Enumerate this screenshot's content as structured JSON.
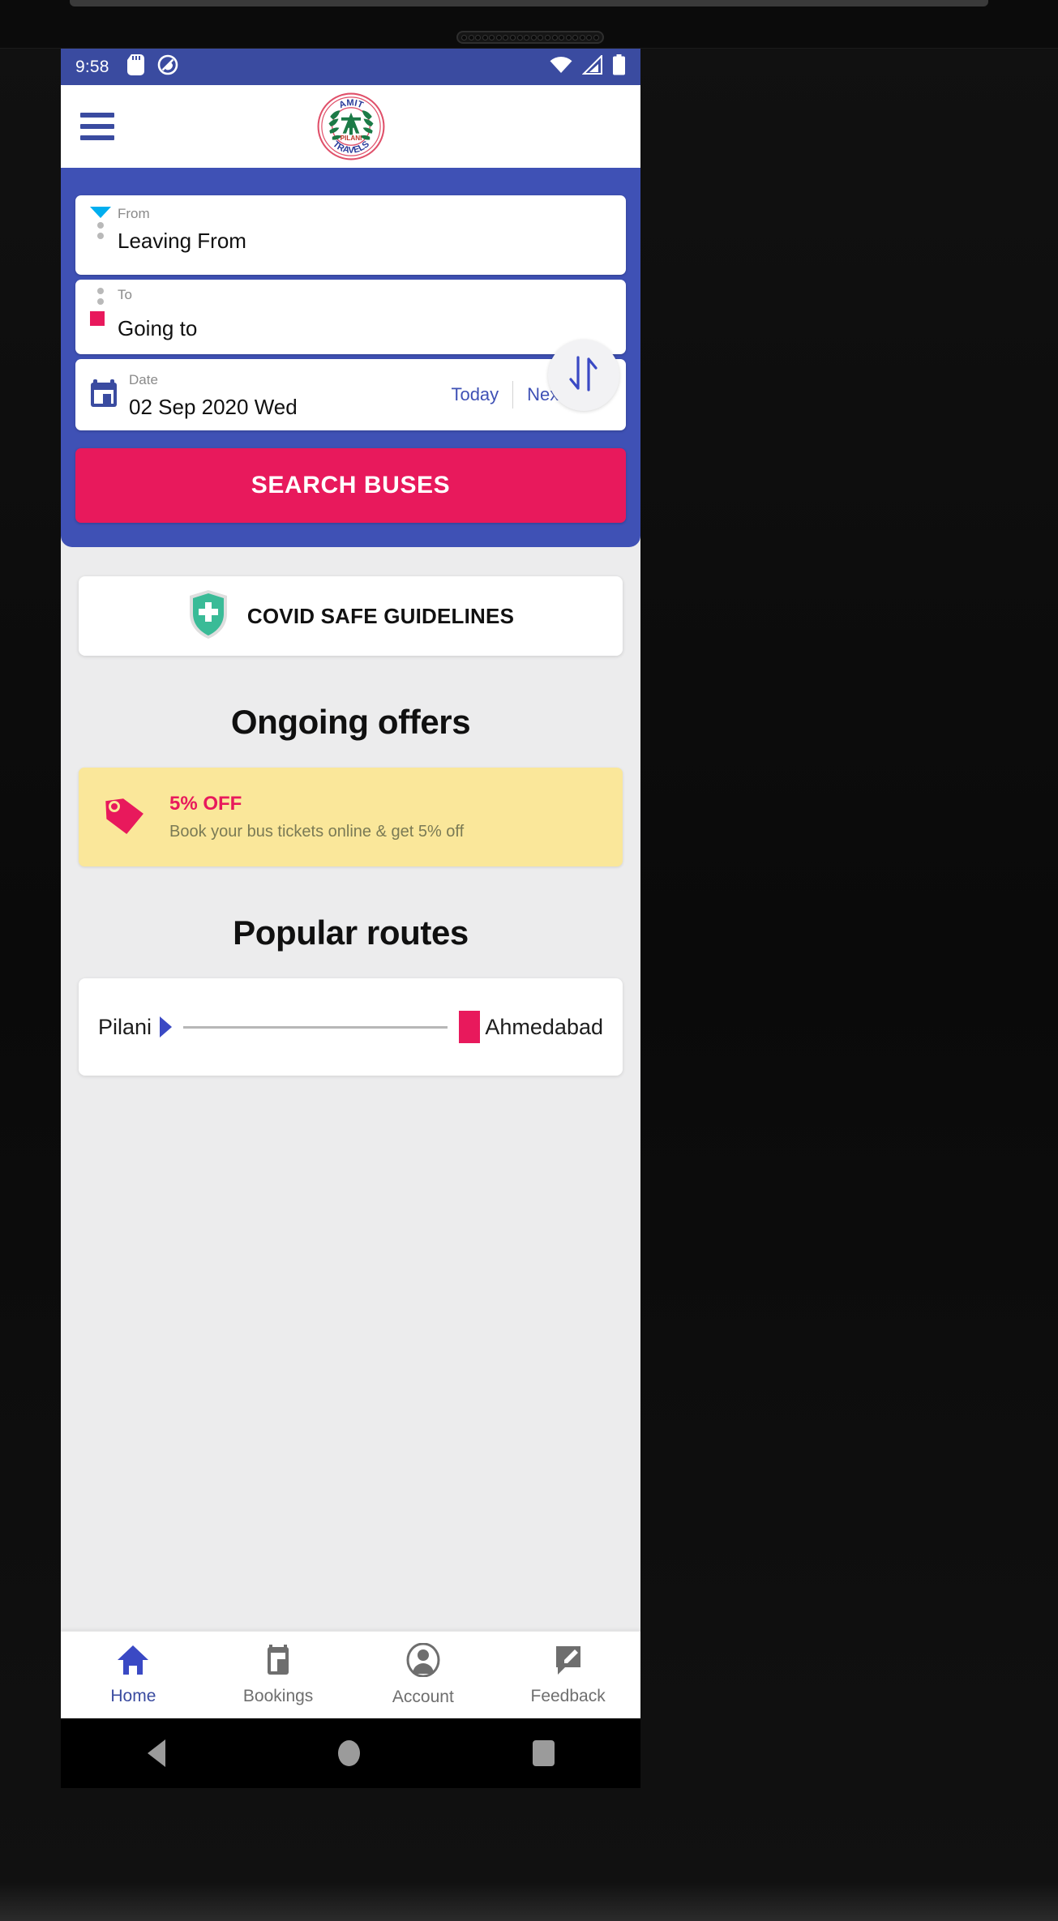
{
  "status_bar": {
    "time": "9:58",
    "left_icons": [
      "sd-card-icon",
      "do-not-disturb-icon"
    ],
    "right_icons": [
      "wifi-icon",
      "cell-signal-icon",
      "battery-icon"
    ],
    "background": "#3A4BA0"
  },
  "app_bar": {
    "menu_icon": "hamburger-menu-icon",
    "logo": {
      "top_text": "AMIT",
      "center_text": "A",
      "sub_text": "PILANI",
      "bottom_text": "TRAVELS",
      "ring_color": "#E0506A",
      "mark_color": "#1B7A46",
      "bottom_text_color": "#2B3C9B"
    }
  },
  "search_panel": {
    "background": "#3F51B5",
    "from": {
      "label": "From",
      "value": "Leaving From",
      "marker": "triangle-down-icon",
      "marker_color": "#00AEEF"
    },
    "to": {
      "label": "To",
      "value": "Going to",
      "marker": "square-icon",
      "marker_color": "#E8195C"
    },
    "swap": {
      "icon": "swap-arrows-icon",
      "color": "#3A49C4"
    },
    "date": {
      "label": "Date",
      "value": "02 Sep 2020 Wed",
      "icon": "calendar-icon",
      "today_label": "Today",
      "next_day_label": "Next day"
    },
    "search_button": {
      "label": "SEARCH BUSES",
      "color": "#E8195C"
    }
  },
  "covid": {
    "label": "COVID SAFE GUIDELINES",
    "icon": "shield-plus-icon",
    "icon_color": "#3ABB97"
  },
  "offers": {
    "title": "Ongoing offers",
    "items": [
      {
        "icon": "price-tag-icon",
        "title": "5% OFF",
        "subtitle": "Book your bus tickets online & get 5% off",
        "background": "#FAE79A",
        "title_color": "#E8195C"
      }
    ]
  },
  "routes": {
    "title": "Popular routes",
    "items": [
      {
        "from": "Pilani",
        "to": "Ahmedabad",
        "from_icon": "triangle-right-icon",
        "to_icon": "square-icon"
      }
    ]
  },
  "bottom_nav": {
    "items": [
      {
        "label": "Home",
        "icon": "home-icon",
        "active": true
      },
      {
        "label": "Bookings",
        "icon": "ticket-icon",
        "active": false
      },
      {
        "label": "Account",
        "icon": "person-circle-icon",
        "active": false
      },
      {
        "label": "Feedback",
        "icon": "feedback-icon",
        "active": false
      }
    ],
    "active_color": "#3A4BA0",
    "inactive_color": "#6E6E6E"
  },
  "android_nav": {
    "back": "back-icon",
    "home": "home-circle-icon",
    "recents": "recents-icon"
  }
}
